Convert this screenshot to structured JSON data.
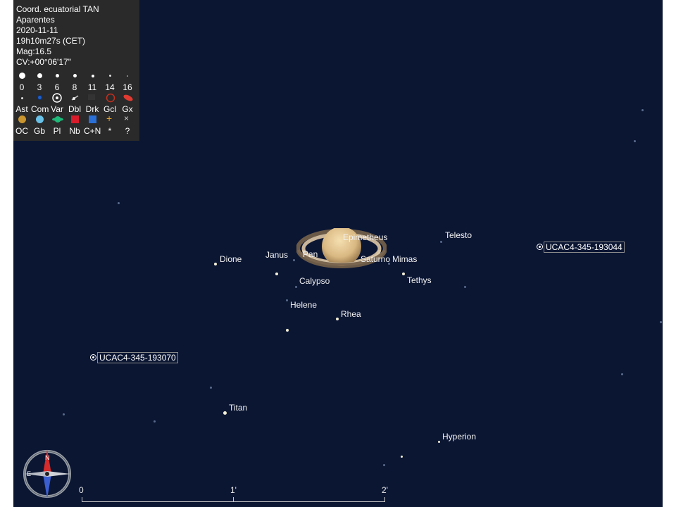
{
  "legend": {
    "projection": "Coord. ecuatorial TAN",
    "mode": "Aparentes",
    "date": "2020-11-11",
    "time": "19h10m27s (CET)",
    "magnitude": "Mag:16.5",
    "field": "CV:+00°06'17\"",
    "mag_labels": [
      "0",
      "3",
      "6",
      "8",
      "11",
      "14",
      "16"
    ],
    "type_labels_1": [
      "Ast",
      "Com",
      "Var",
      "Dbl",
      "Drk",
      "Gcl",
      "Gx"
    ],
    "type_labels_2": [
      "OC",
      "Gb",
      "Pl",
      "Nb",
      "C+N",
      "*",
      "?"
    ],
    "colors": {
      "Com": "#1f5fc8",
      "Gcl": "#c23020",
      "Gx": "#e23a30",
      "OC": "#c8952f",
      "Gb": "#69c0e6",
      "Pl": "#1fb97a",
      "Nb": "#d81c2c",
      "CN": "#2a6fd6",
      "star": "#e6a530"
    }
  },
  "planet": {
    "name": "Saturno"
  },
  "moons": {
    "epimetheus": "Epimetheus",
    "telesto": "Telesto",
    "janus": "Janus",
    "pan": "Pan",
    "mimas": "Mimas",
    "dione": "Dione",
    "calypso": "Calypso",
    "tethys": "Tethys",
    "helene": "Helene",
    "rhea": "Rhea",
    "titan": "Titan",
    "hyperion": "Hyperion"
  },
  "catalog_stars": {
    "star_a": "UCAC4-345-193044",
    "star_b": "UCAC4-345-193070"
  },
  "scale": {
    "labels": [
      "0",
      "1'",
      "2'"
    ]
  },
  "compass": {
    "north": "N",
    "east": "E"
  }
}
